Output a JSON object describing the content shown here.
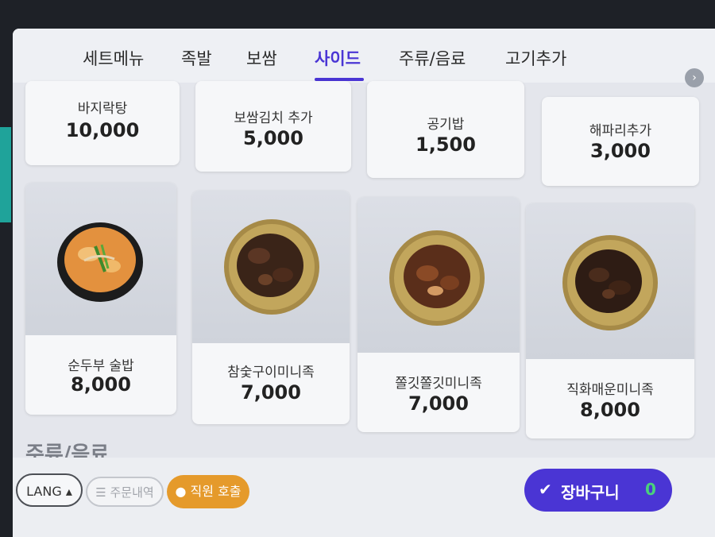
{
  "tabs": [
    {
      "label": "세트메뉴"
    },
    {
      "label": "족발"
    },
    {
      "label": "보쌈"
    },
    {
      "label": "사이드"
    },
    {
      "label": "주류/음료"
    },
    {
      "label": "고기추가"
    }
  ],
  "top_items": [
    {
      "name": "바지락탕",
      "price": "10,000"
    },
    {
      "name": "보쌈김치 추가",
      "price": "5,000"
    },
    {
      "name": "공기밥",
      "price": "1,500"
    },
    {
      "name": "해파리추가",
      "price": "3,000"
    }
  ],
  "photo_items": [
    {
      "name": "순두부 술밥",
      "price": "8,000"
    },
    {
      "name": "참숯구이미니족",
      "price": "7,000"
    },
    {
      "name": "쫄깃쫄깃미니족",
      "price": "7,000"
    },
    {
      "name": "직화매운미니족",
      "price": "8,000"
    }
  ],
  "section_title": "주류/음료",
  "bottom_bar": {
    "lang_label": "LANG ▴",
    "orders_label": "☰ 주문내역",
    "staff_label": "직원 호출"
  },
  "cart": {
    "check_icon": "✔",
    "label": "장바구니",
    "count": "0"
  },
  "colors": {
    "accent": "#4a35d4",
    "staff": "#e59a2b",
    "cart_count": "#4ad07c"
  }
}
